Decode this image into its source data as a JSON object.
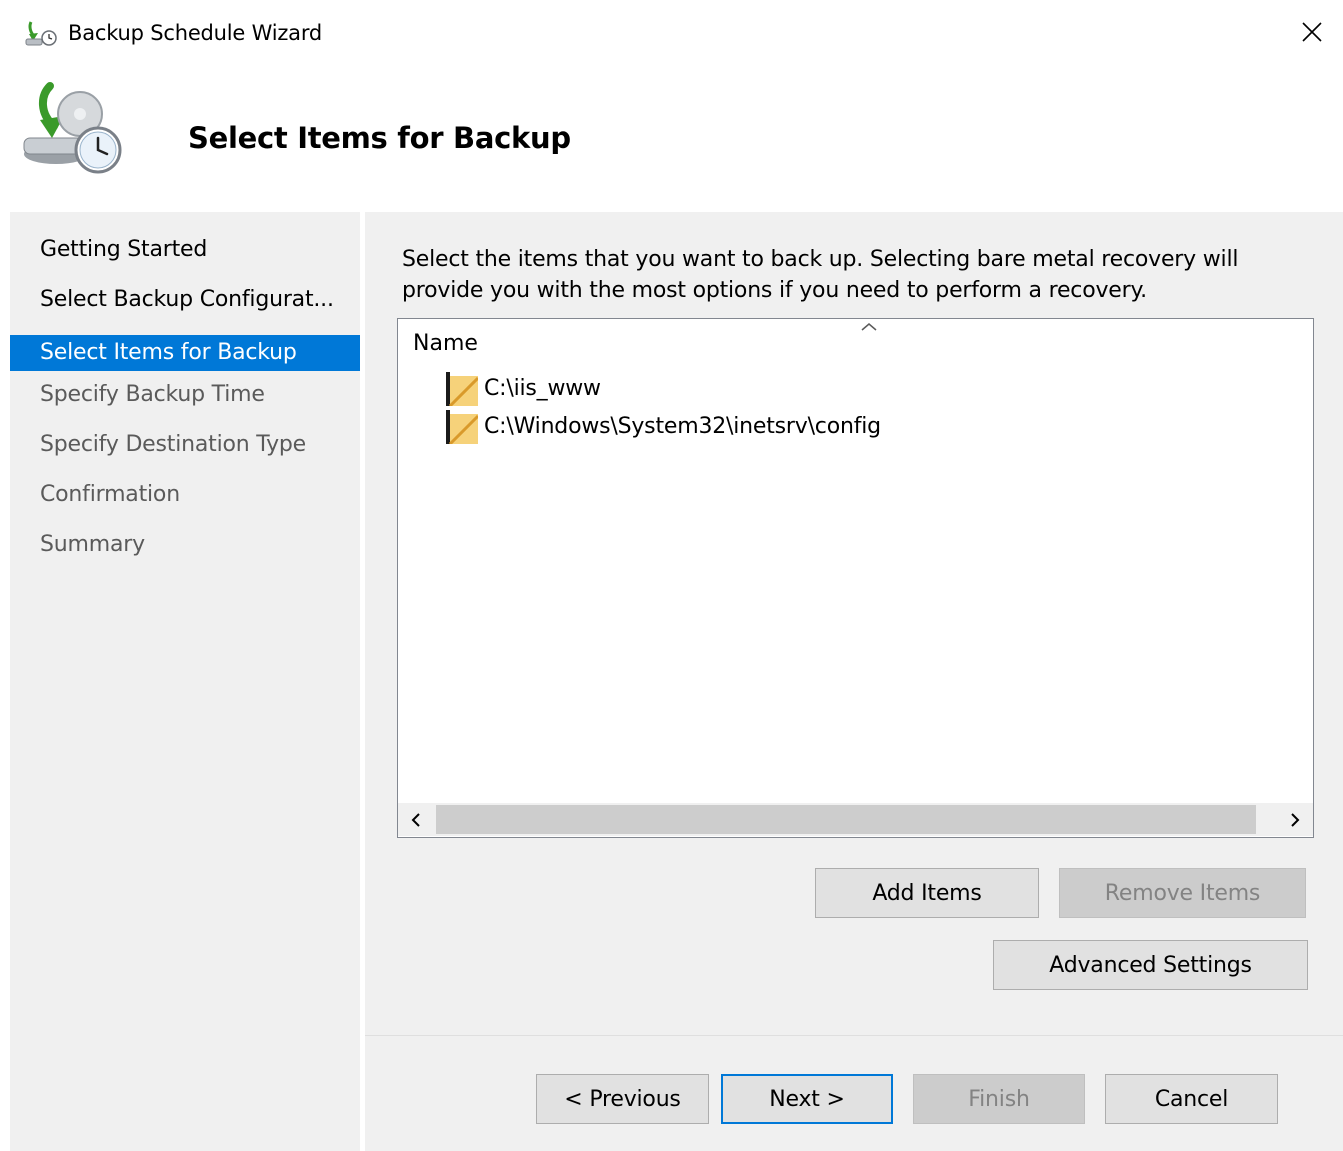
{
  "window": {
    "title": "Backup Schedule Wizard",
    "close_label": "✕",
    "icon": "backup-schedule-icon"
  },
  "header": {
    "title": "Select Items for Backup",
    "icon": "backup-disk-clock-icon"
  },
  "nav": {
    "items": [
      {
        "label": "Getting Started",
        "state": "done"
      },
      {
        "label": "Select Backup Configurat...",
        "state": "done"
      },
      {
        "label": "Select Items for Backup",
        "state": "active"
      },
      {
        "label": "Specify Backup Time",
        "state": "pending"
      },
      {
        "label": "Specify Destination Type",
        "state": "pending"
      },
      {
        "label": "Confirmation",
        "state": "pending"
      },
      {
        "label": "Summary",
        "state": "pending"
      }
    ]
  },
  "main": {
    "description": "Select the items that you want to back up. Selecting bare metal recovery will provide you with the most options if you need to perform a recovery.",
    "list": {
      "column_header": "Name",
      "items": [
        {
          "name": "C:\\iis_www",
          "icon": "folder-icon"
        },
        {
          "name": "C:\\Windows\\System32\\inetsrv\\config",
          "icon": "folder-icon"
        }
      ]
    },
    "buttons": {
      "add_items": "Add Items",
      "remove_items": "Remove Items",
      "advanced_settings": "Advanced Settings"
    }
  },
  "footer": {
    "previous": "< Previous",
    "next": "Next >",
    "finish": "Finish",
    "cancel": "Cancel"
  },
  "colors": {
    "accent": "#0078d7",
    "panel": "#f0f0f0",
    "button": "#e1e1e1",
    "disabled_button": "#cccccc"
  }
}
